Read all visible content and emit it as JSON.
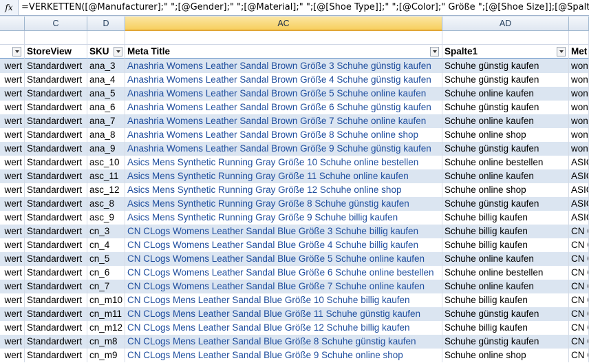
{
  "formula_bar": {
    "fx_label": "fx",
    "formula": "=VERKETTEN([@Manufacturer];\" \";[@Gender];\" \";[@Material];\" \";[@[Shoe Type]];\" \";[@Color];\" Größe \";[@[Shoe Size]];[@Spalte1])"
  },
  "column_letters": [
    "C",
    "D",
    "AC",
    "AD"
  ],
  "selected_column": "AC",
  "headers": {
    "c": "StoreView",
    "d": "SKU",
    "ac": "Meta Title",
    "ad": "Spalte1",
    "ae": "Met"
  },
  "rows": [
    {
      "b": "wert",
      "c": "Standardwert",
      "d": "ana_3",
      "ac": "Anashria Womens Leather Sandal Brown Größe 3 Schuhe günstig kaufen",
      "ad": "Schuhe günstig kaufen",
      "ae": "won"
    },
    {
      "b": "wert",
      "c": "Standardwert",
      "d": "ana_4",
      "ac": "Anashria Womens Leather Sandal Brown Größe 4 Schuhe günstig kaufen",
      "ad": "Schuhe günstig kaufen",
      "ae": "won"
    },
    {
      "b": "wert",
      "c": "Standardwert",
      "d": "ana_5",
      "ac": "Anashria Womens Leather Sandal Brown Größe 5 Schuhe online kaufen",
      "ad": "Schuhe online kaufen",
      "ae": "won"
    },
    {
      "b": "wert",
      "c": "Standardwert",
      "d": "ana_6",
      "ac": "Anashria Womens Leather Sandal Brown Größe 6 Schuhe günstig kaufen",
      "ad": "Schuhe günstig kaufen",
      "ae": "won"
    },
    {
      "b": "wert",
      "c": "Standardwert",
      "d": "ana_7",
      "ac": "Anashria Womens Leather Sandal Brown Größe 7 Schuhe online kaufen",
      "ad": "Schuhe online kaufen",
      "ae": "won"
    },
    {
      "b": "wert",
      "c": "Standardwert",
      "d": "ana_8",
      "ac": "Anashria Womens Leather Sandal Brown Größe 8 Schuhe online shop",
      "ad": "Schuhe online shop",
      "ae": "won"
    },
    {
      "b": "wert",
      "c": "Standardwert",
      "d": "ana_9",
      "ac": "Anashria Womens Leather Sandal Brown Größe 9 Schuhe günstig kaufen",
      "ad": "Schuhe günstig kaufen",
      "ae": "won"
    },
    {
      "b": "wert",
      "c": "Standardwert",
      "d": "asc_10",
      "ac": "Asics Mens Synthetic Running Gray Größe 10 Schuhe online bestellen",
      "ad": "Schuhe online bestellen",
      "ae": "ASIC"
    },
    {
      "b": "wert",
      "c": "Standardwert",
      "d": "asc_11",
      "ac": "Asics Mens Synthetic Running Gray Größe 11 Schuhe online kaufen",
      "ad": "Schuhe online kaufen",
      "ae": "ASIC"
    },
    {
      "b": "wert",
      "c": "Standardwert",
      "d": "asc_12",
      "ac": "Asics Mens Synthetic Running Gray Größe 12 Schuhe online shop",
      "ad": "Schuhe online shop",
      "ae": "ASIC"
    },
    {
      "b": "wert",
      "c": "Standardwert",
      "d": "asc_8",
      "ac": "Asics Mens Synthetic Running Gray Größe 8 Schuhe günstig kaufen",
      "ad": "Schuhe günstig kaufen",
      "ae": "ASIC"
    },
    {
      "b": "wert",
      "c": "Standardwert",
      "d": "asc_9",
      "ac": "Asics Mens Synthetic Running Gray Größe 9 Schuhe billig kaufen",
      "ad": "Schuhe billig kaufen",
      "ae": "ASIC"
    },
    {
      "b": "wert",
      "c": "Standardwert",
      "d": "cn_3",
      "ac": "CN CLogs Womens Leather Sandal Blue Größe 3 Schuhe billig kaufen",
      "ad": "Schuhe billig kaufen",
      "ae": "CN C"
    },
    {
      "b": "wert",
      "c": "Standardwert",
      "d": "cn_4",
      "ac": "CN CLogs Womens Leather Sandal Blue Größe 4 Schuhe billig kaufen",
      "ad": "Schuhe billig kaufen",
      "ae": "CN C"
    },
    {
      "b": "wert",
      "c": "Standardwert",
      "d": "cn_5",
      "ac": "CN CLogs Womens Leather Sandal Blue Größe 5 Schuhe online kaufen",
      "ad": "Schuhe online kaufen",
      "ae": "CN C"
    },
    {
      "b": "wert",
      "c": "Standardwert",
      "d": "cn_6",
      "ac": "CN CLogs Womens Leather Sandal Blue Größe 6 Schuhe online bestellen",
      "ad": "Schuhe online bestellen",
      "ae": "CN C"
    },
    {
      "b": "wert",
      "c": "Standardwert",
      "d": "cn_7",
      "ac": "CN CLogs Womens Leather Sandal Blue Größe 7 Schuhe online kaufen",
      "ad": "Schuhe online kaufen",
      "ae": "CN C"
    },
    {
      "b": "wert",
      "c": "Standardwert",
      "d": "cn_m10",
      "ac": "CN CLogs Mens Leather Sandal Blue Größe 10 Schuhe billig kaufen",
      "ad": "Schuhe billig kaufen",
      "ae": "CN C"
    },
    {
      "b": "wert",
      "c": "Standardwert",
      "d": "cn_m11",
      "ac": "CN CLogs Mens Leather Sandal Blue Größe 11 Schuhe günstig kaufen",
      "ad": "Schuhe günstig kaufen",
      "ae": "CN C"
    },
    {
      "b": "wert",
      "c": "Standardwert",
      "d": "cn_m12",
      "ac": "CN CLogs Mens Leather Sandal Blue Größe 12 Schuhe billig kaufen",
      "ad": "Schuhe billig kaufen",
      "ae": "CN C"
    },
    {
      "b": "wert",
      "c": "Standardwert",
      "d": "cn_m8",
      "ac": "CN CLogs Mens Leather Sandal Blue Größe 8 Schuhe günstig kaufen",
      "ad": "Schuhe günstig kaufen",
      "ae": "CN C"
    },
    {
      "b": "wert",
      "c": "Standardwert",
      "d": "cn_m9",
      "ac": "CN CLogs Mens Leather Sandal Blue Größe 9 Schuhe online shop",
      "ad": "Schuhe online shop",
      "ae": "CN C"
    }
  ]
}
